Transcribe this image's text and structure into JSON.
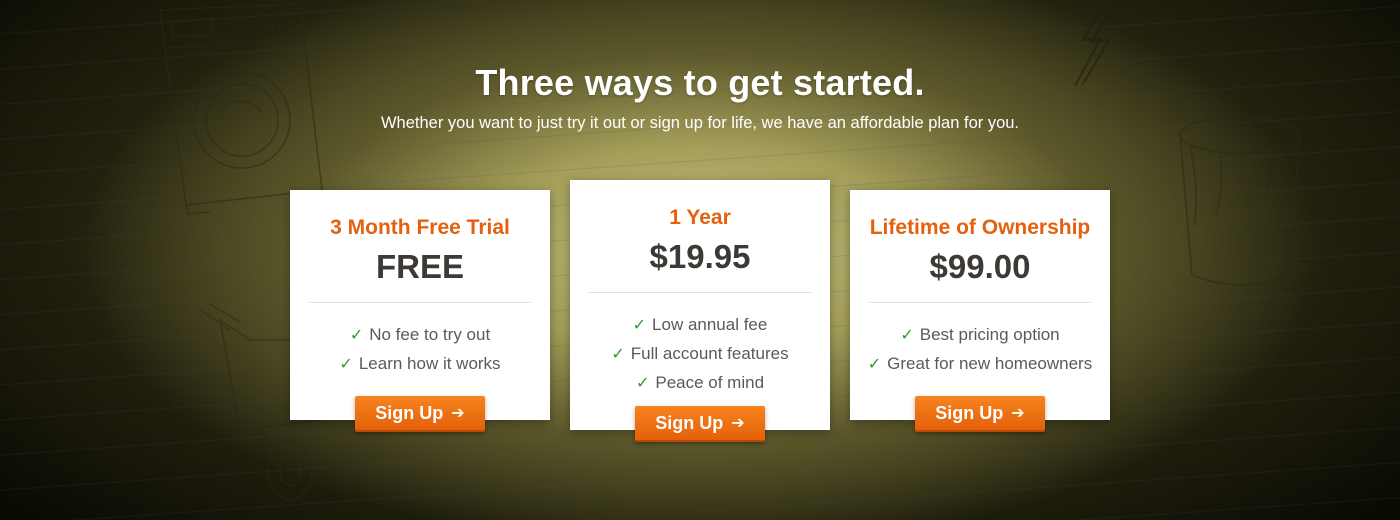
{
  "heading": {
    "title": "Three ways to get started.",
    "subtitle": "Whether you want to just try it out or sign up for life, we have an affordable plan for you."
  },
  "plans": [
    {
      "name": "3 Month Free Trial",
      "price": "FREE",
      "features": [
        "No fee to try out",
        "Learn how it works"
      ],
      "cta": "Sign Up"
    },
    {
      "name": "1 Year",
      "price": "$19.95",
      "features": [
        "Low annual fee",
        "Full account features",
        "Peace of mind"
      ],
      "cta": "Sign Up"
    },
    {
      "name": "Lifetime of Ownership",
      "price": "$99.00",
      "features": [
        "Best pricing option",
        "Great for new homeowners"
      ],
      "cta": "Sign Up"
    }
  ],
  "icons": {
    "check": "check-icon",
    "arrow": "arrow-right-icon"
  },
  "colors": {
    "accent": "#e3610f",
    "button": "#f0761a",
    "check": "#2f9a2f",
    "price_text": "#3d3a36"
  }
}
